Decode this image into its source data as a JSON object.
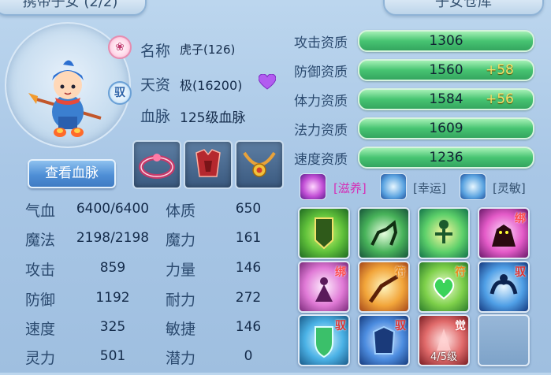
{
  "tabs": {
    "left": "携带子女 (2/2)",
    "right": "子女仓库"
  },
  "profile": {
    "name_label": "名称",
    "name_value": "虎子(126)",
    "talent_label": "天资",
    "talent_value": "极(16200)",
    "bloodline_label": "血脉",
    "bloodline_value": "125级血脉",
    "view_bloodline_button": "查看血脉",
    "badge_lotus": "❀",
    "badge_qu": "驭"
  },
  "stats": [
    {
      "label": "气血",
      "value": "6400/6400",
      "label2": "体质",
      "value2": "650"
    },
    {
      "label": "魔法",
      "value": "2198/2198",
      "label2": "魔力",
      "value2": "161"
    },
    {
      "label": "攻击",
      "value": "859",
      "label2": "力量",
      "value2": "146"
    },
    {
      "label": "防御",
      "value": "1192",
      "label2": "耐力",
      "value2": "272"
    },
    {
      "label": "速度",
      "value": "325",
      "label2": "敏捷",
      "value2": "146"
    },
    {
      "label": "灵力",
      "value": "501",
      "label2": "潜力",
      "value2": "0"
    }
  ],
  "aptitudes": [
    {
      "label": "攻击资质",
      "value": "1306",
      "bonus": ""
    },
    {
      "label": "防御资质",
      "value": "1560",
      "bonus": "+58"
    },
    {
      "label": "体力资质",
      "value": "1584",
      "bonus": "+56"
    },
    {
      "label": "法力资质",
      "value": "1609",
      "bonus": ""
    },
    {
      "label": "速度资质",
      "value": "1236",
      "bonus": ""
    }
  ],
  "special_skills": [
    {
      "text": "[滋养]",
      "color": "#d52fb7"
    },
    {
      "text": "[幸运]",
      "color": "#33506f"
    },
    {
      "text": "[灵敏]",
      "color": "#33506f"
    }
  ],
  "skills": [
    {
      "tag": "",
      "tag_type": "",
      "level": ""
    },
    {
      "tag": "",
      "tag_type": "",
      "level": ""
    },
    {
      "tag": "",
      "tag_type": "",
      "level": ""
    },
    {
      "tag": "绑",
      "tag_type": "bind",
      "level": ""
    },
    {
      "tag": "绑",
      "tag_type": "bind",
      "level": ""
    },
    {
      "tag": "符",
      "tag_type": "fu",
      "level": ""
    },
    {
      "tag": "符",
      "tag_type": "fu",
      "level": ""
    },
    {
      "tag": "驭",
      "tag_type": "qu",
      "level": ""
    },
    {
      "tag": "驭",
      "tag_type": "qu",
      "level": ""
    },
    {
      "tag": "驭",
      "tag_type": "qu",
      "level": ""
    },
    {
      "tag": "觉",
      "tag_type": "jue",
      "level": "4/5级"
    },
    {
      "tag": "",
      "tag_type": "",
      "level": ""
    }
  ]
}
